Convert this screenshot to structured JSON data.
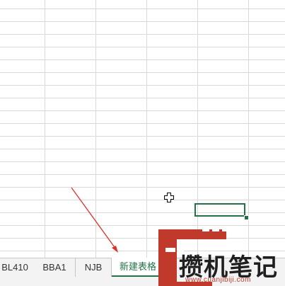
{
  "sheet_tabs": [
    {
      "label": "BL410",
      "active": false
    },
    {
      "label": "BBA1",
      "active": false
    },
    {
      "label": "NJB",
      "active": false
    },
    {
      "label": "新建表格",
      "active": true
    }
  ],
  "watermark": {
    "logo_text": "攒机笔记",
    "url": "www.cuanjibiji.com"
  },
  "colors": {
    "accent": "#217346",
    "annotation_arrow": "#e0302a",
    "watermark_red": "#c0392b"
  }
}
